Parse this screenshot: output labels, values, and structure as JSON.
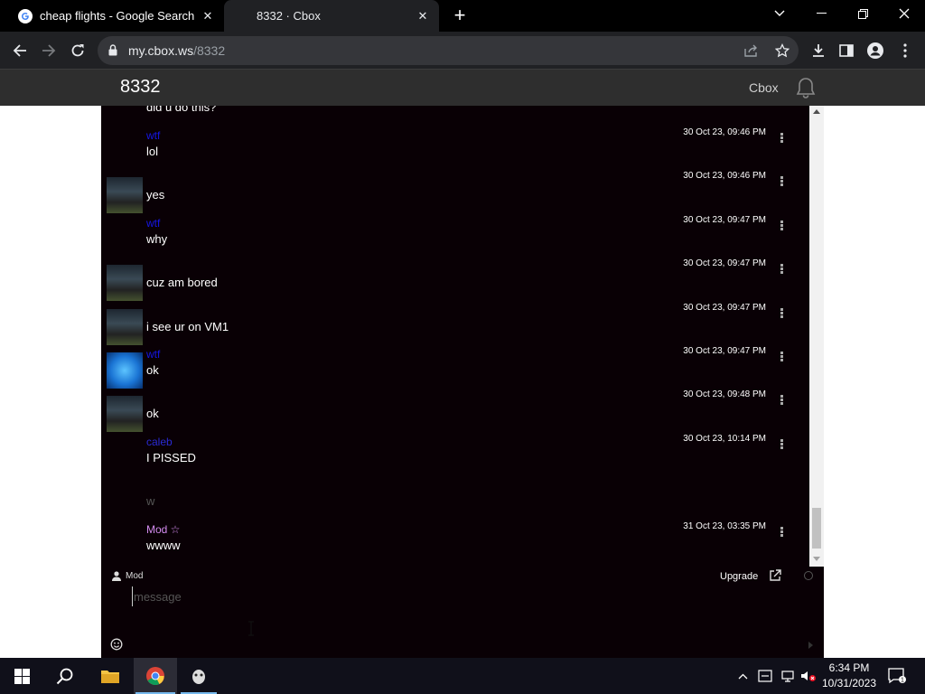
{
  "browser": {
    "tabs": [
      {
        "title": "cheap flights - Google Search",
        "active": false,
        "icon": "google-icon"
      },
      {
        "title": "8332 · Cbox",
        "active": true,
        "icon": "cbox-icon"
      }
    ],
    "url_host": "my.cbox.ws",
    "url_path": "/8332"
  },
  "page": {
    "title": "8332",
    "brand": "Cbox"
  },
  "chat": {
    "top_partial_text": "did u do this?",
    "messages": [
      {
        "name": "wtf",
        "text": "lol",
        "time": "30 Oct 23, 09:46 PM",
        "avatar": "none",
        "name_color": "#1616e6"
      },
      {
        "name": "",
        "text": "yes",
        "time": "30 Oct 23, 09:46 PM",
        "avatar": "screen"
      },
      {
        "name": "wtf",
        "text": "why",
        "time": "30 Oct 23, 09:47 PM",
        "avatar": "none",
        "name_color": "#1616e6"
      },
      {
        "name": "",
        "text": "cuz am bored",
        "time": "30 Oct 23, 09:47 PM",
        "avatar": "screen"
      },
      {
        "name": "",
        "text": "i see ur on VM1",
        "time": "30 Oct 23, 09:47 PM",
        "avatar": "screen"
      },
      {
        "name": "wtf",
        "text": "ok",
        "time": "30 Oct 23, 09:47 PM",
        "avatar": "windows",
        "name_color": "#1616e6"
      },
      {
        "name": "",
        "text": "ok",
        "time": "30 Oct 23, 09:48 PM",
        "avatar": "screen"
      },
      {
        "name": "caleb",
        "text": "I PISSED",
        "time": "30 Oct 23, 10:14 PM",
        "avatar": "none",
        "name_color": "#2a2ad4"
      },
      {
        "name": "",
        "text": "w",
        "time": "",
        "avatar": "none",
        "dim": true
      },
      {
        "name": "Mod ☆",
        "text": "wwww",
        "time": "31 Oct 23, 03:35 PM",
        "avatar": "none",
        "name_color": "#d58cf0"
      }
    ],
    "composer": {
      "user": "Mod",
      "upgrade": "Upgrade",
      "placeholder": "message"
    }
  },
  "taskbar": {
    "clock_time": "6:34 PM",
    "clock_date": "10/31/2023",
    "notification_count": "1"
  },
  "colors": {
    "chat_bg": "#090005",
    "header_bg": "#2e2e2e",
    "chrome_bg": "#202124"
  }
}
